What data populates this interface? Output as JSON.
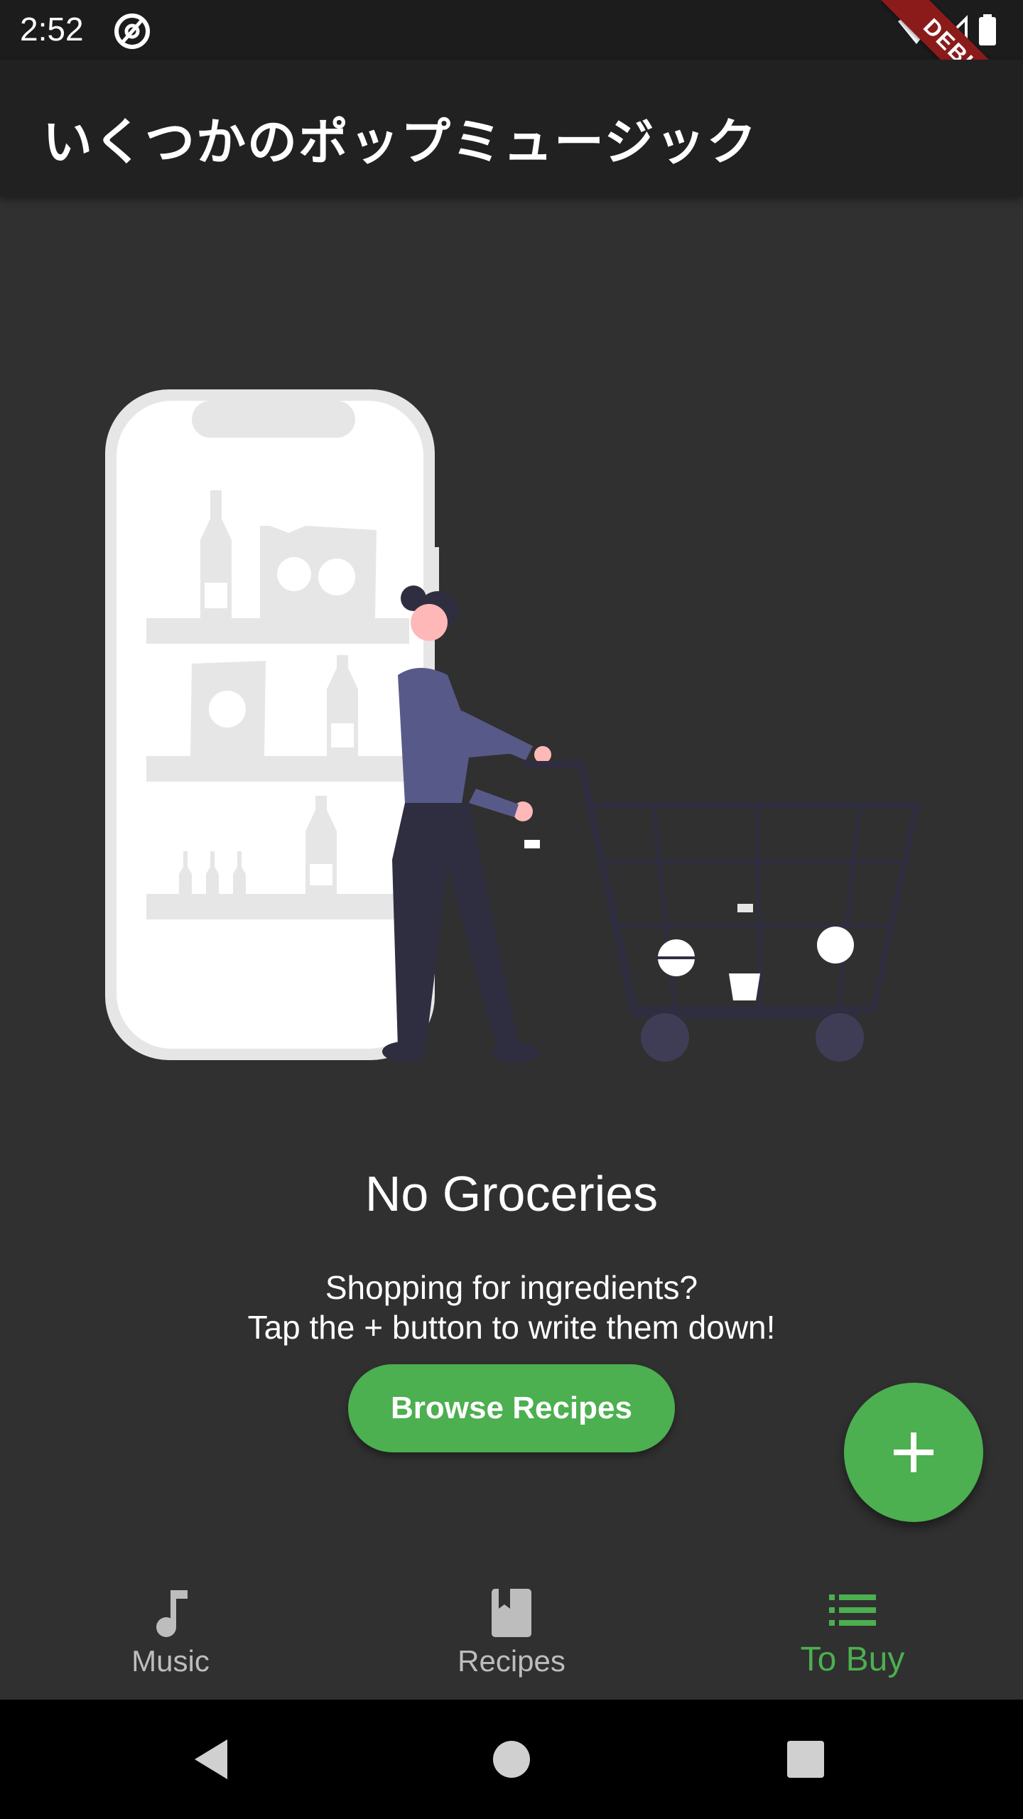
{
  "status_bar": {
    "time": "2:52",
    "app_icon": "at-sign-icon",
    "right_icons": [
      "wifi-icon",
      "cell-signal-icon",
      "battery-icon"
    ]
  },
  "debug_banner": {
    "label": "DEBUG"
  },
  "app_bar": {
    "title": "いくつかのポップミュージック"
  },
  "empty_state": {
    "title": "No Groceries",
    "message_line1": "Shopping for ingredients?",
    "message_line2": "Tap the + button to write them down!",
    "browse_button": "Browse Recipes",
    "illustration": "shopping-cart-woman-illustration"
  },
  "fab": {
    "icon": "plus-icon"
  },
  "bottom_nav": {
    "items": [
      {
        "label": "Music",
        "icon": "music-note-icon",
        "active": false
      },
      {
        "label": "Recipes",
        "icon": "book-icon",
        "active": false
      },
      {
        "label": "To Buy",
        "icon": "list-icon",
        "active": true
      }
    ]
  },
  "system_nav": {
    "icons": [
      "back-icon",
      "home-icon",
      "recents-icon"
    ]
  },
  "colors": {
    "accent": "#4caf50",
    "background": "#303030",
    "app_bar": "#212121",
    "debug": "#8b1b1b"
  }
}
